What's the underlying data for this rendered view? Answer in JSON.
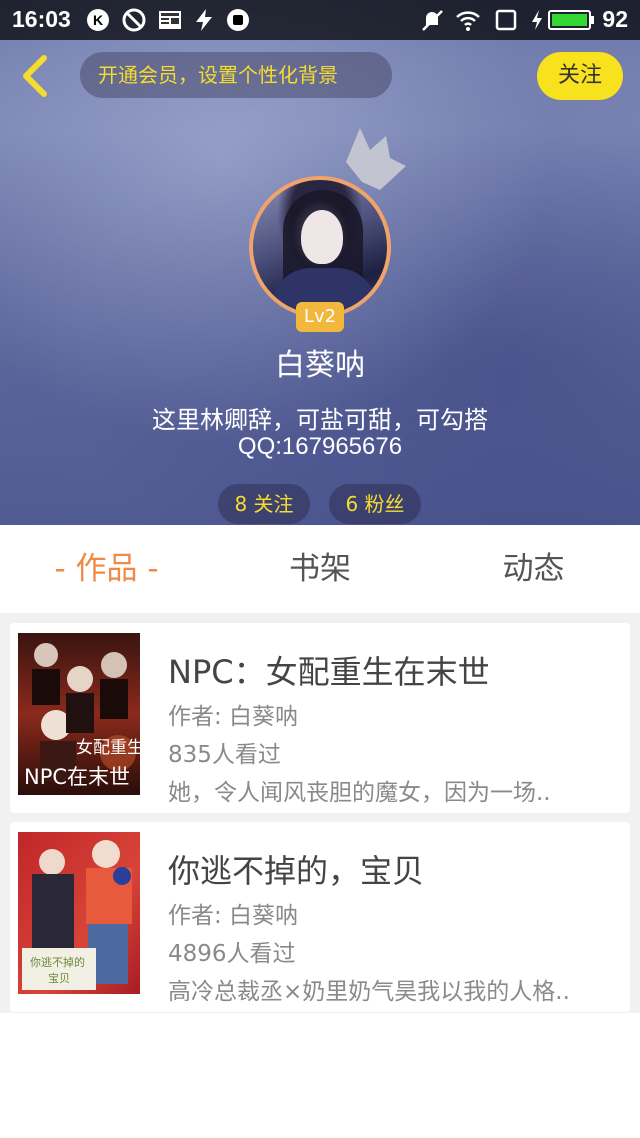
{
  "status_bar": {
    "time": "16:03",
    "battery_pct": "92",
    "icons": [
      "k-app-icon",
      "block-icon",
      "news-icon",
      "bolt-icon",
      "shield-app-icon",
      "mute-icon",
      "wifi-icon",
      "screen-icon",
      "charging-icon",
      "battery-icon"
    ]
  },
  "top_bar": {
    "vip_prompt": "开通会员，设置个性化背景",
    "follow_label": "关注"
  },
  "profile": {
    "level": "Lv2",
    "name": "白葵呐",
    "bio": "这里林卿辞，可盐可甜，可勾搭",
    "qq": "QQ:167965676",
    "following": "8 关注",
    "fans": "6 粉丝"
  },
  "tabs": [
    {
      "label": "- 作品 -",
      "active": true
    },
    {
      "label": "书架",
      "active": false
    },
    {
      "label": "动态",
      "active": false
    }
  ],
  "books": [
    {
      "title": "NPC：女配重生在末世",
      "author": "作者: 白葵呐",
      "views": "835人看过",
      "desc": "她，令人闻风丧胆的魔女，因为一场..",
      "cover_text": [
        "女配重生",
        "NPC在末世"
      ]
    },
    {
      "title": "你逃不掉的，宝贝",
      "author": "作者: 白葵呐",
      "views": "4896人看过",
      "desc": "高冷总裁丞×奶里奶气昊我以我的人格..",
      "cover_text": [
        "你逃不掉的",
        "宝贝"
      ]
    }
  ],
  "colors": {
    "accent": "#ef8a45",
    "follow_yellow": "#f8e21e",
    "vip_text": "#f6dc2f",
    "level_badge": "#f2b73d",
    "battery_green": "#33d633"
  }
}
